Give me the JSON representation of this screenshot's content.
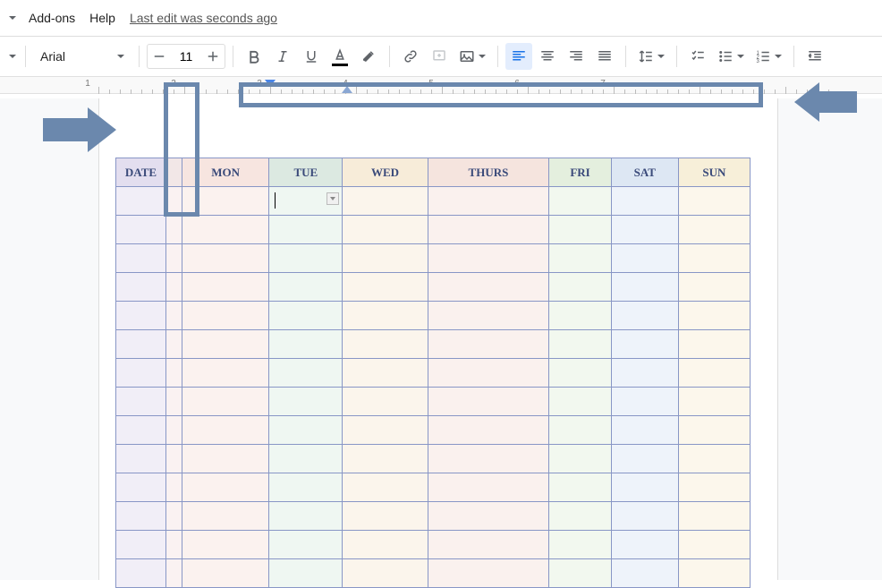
{
  "menu": {
    "addons": "Add-ons",
    "help": "Help",
    "lastEdit": "Last edit was seconds ago"
  },
  "toolbar": {
    "fontName": "Arial",
    "fontSize": "11"
  },
  "ruler": {
    "marks": [
      "1",
      "2",
      "3",
      "4",
      "5",
      "6",
      "7"
    ]
  },
  "table": {
    "headers": [
      "DATE",
      "",
      "MON",
      "TUE",
      "WED",
      "THURS",
      "FRI",
      "SAT",
      "SUN"
    ],
    "rows": 14
  },
  "colors": {
    "annotation": "#6b88ad"
  }
}
